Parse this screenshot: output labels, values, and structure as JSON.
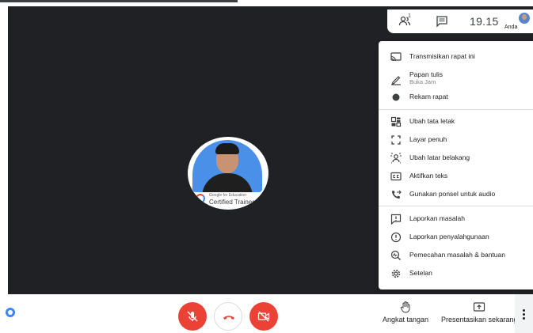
{
  "topbar": {
    "participants_count": "1",
    "clock": "19.15",
    "user_name": "Anda"
  },
  "tile": {
    "badge_small": "Google for Education",
    "badge_main": "Certified Trainer"
  },
  "menu": {
    "items": [
      {
        "label": "Transmisikan rapat ini",
        "icon": "cast-icon"
      },
      {
        "label": "Papan tulis",
        "sublabel": "Buka Jam",
        "icon": "pen-icon"
      },
      {
        "label": "Rekam rapat",
        "icon": "record-icon"
      },
      {
        "label": "Ubah tata letak",
        "icon": "layout-icon"
      },
      {
        "label": "Layar penuh",
        "icon": "fullscreen-icon"
      },
      {
        "label": "Ubah latar belakang",
        "icon": "background-icon"
      },
      {
        "label": "Aktifkan teks",
        "icon": "captions-icon"
      },
      {
        "label": "Gunakan ponsel untuk audio",
        "icon": "phone-forward-icon"
      },
      {
        "label": "Laporkan masalah",
        "icon": "feedback-icon"
      },
      {
        "label": "Laporkan penyalahgunaan",
        "icon": "report-icon"
      },
      {
        "label": "Pemecahan masalah & bantuan",
        "icon": "troubleshoot-icon"
      },
      {
        "label": "Setelan",
        "icon": "settings-icon"
      }
    ]
  },
  "bottombar": {
    "raise_hand_label": "Angkat tangan",
    "present_label": "Presentasikan sekarang"
  },
  "colors": {
    "stage": "#202124",
    "danger": "#ea4335",
    "text": "#202124",
    "muted": "#80868b"
  }
}
